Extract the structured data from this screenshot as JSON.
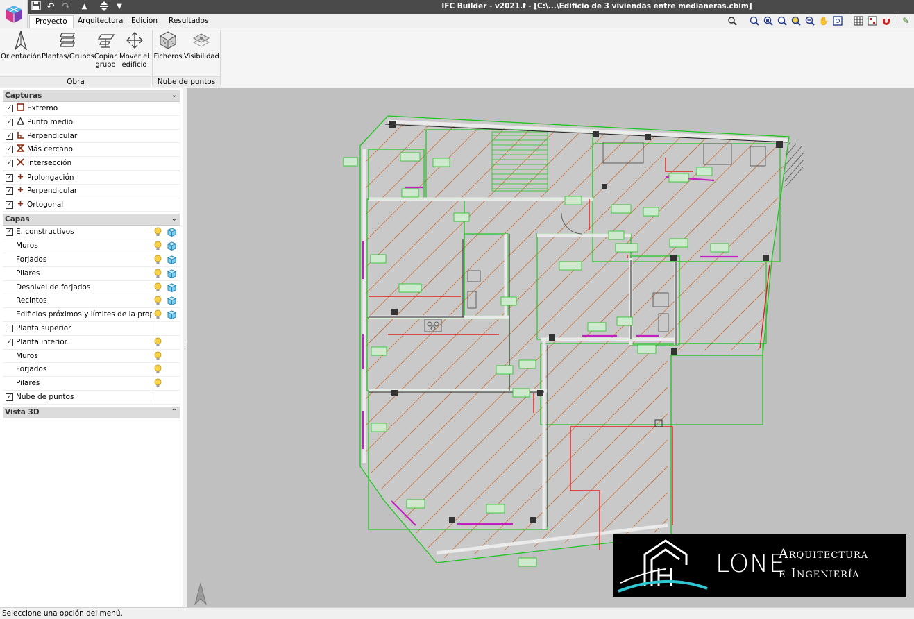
{
  "window": {
    "title": "IFC Builder - v2021.f - [C:\\...\\Edificio de 3 viviendas entre medianeras.cbim]"
  },
  "tabs": [
    {
      "label": "Proyecto",
      "active": true
    },
    {
      "label": "Arquitectura",
      "active": false
    },
    {
      "label": "Edición",
      "active": false
    },
    {
      "label": "Resultados",
      "active": false
    }
  ],
  "ribbon": {
    "obra": {
      "group_label": "Obra",
      "buttons": [
        {
          "label": "Orientación",
          "icon": "north-arrow-icon"
        },
        {
          "label": "Plantas/Grupos",
          "icon": "floors-stack-icon"
        },
        {
          "label": "Copiar grupo",
          "icon": "copy-floor-icon"
        },
        {
          "label": "Mover el edificio",
          "icon": "move-arrows-icon"
        }
      ]
    },
    "nube": {
      "group_label": "Nube de puntos",
      "buttons": [
        {
          "label": "Ficheros",
          "icon": "point-cloud-file-icon"
        },
        {
          "label": "Visibilidad",
          "icon": "visibility-layer-icon"
        }
      ]
    }
  },
  "capturas": {
    "header": "Capturas",
    "items": [
      {
        "label": "Extremo",
        "checked": true,
        "icon": "endpoint-square-icon"
      },
      {
        "label": "Punto medio",
        "checked": true,
        "icon": "midpoint-triangle-icon"
      },
      {
        "label": "Perpendicular",
        "checked": true,
        "icon": "perpendicular-icon"
      },
      {
        "label": "Más cercano",
        "checked": true,
        "icon": "nearest-hourglass-icon"
      },
      {
        "label": "Intersección",
        "checked": true,
        "icon": "intersection-x-icon"
      },
      {
        "label": "Prolongación",
        "checked": true,
        "icon": "plus-icon"
      },
      {
        "label": "Perpendicular",
        "checked": true,
        "icon": "plus-icon"
      },
      {
        "label": "Ortogonal",
        "checked": true,
        "icon": "plus-icon"
      }
    ]
  },
  "capas": {
    "header": "Capas",
    "items": [
      {
        "label": "E. constructivos",
        "checkbox": true,
        "checked": true,
        "bulb": true,
        "cube": true,
        "indent": false
      },
      {
        "label": "Muros",
        "checkbox": false,
        "bulb": true,
        "cube": true,
        "indent": true
      },
      {
        "label": "Forjados",
        "checkbox": false,
        "bulb": true,
        "cube": true,
        "indent": true
      },
      {
        "label": "Pilares",
        "checkbox": false,
        "bulb": true,
        "cube": true,
        "indent": true
      },
      {
        "label": "Desnivel de forjados",
        "checkbox": false,
        "bulb": true,
        "cube": true,
        "indent": true
      },
      {
        "label": "Recintos",
        "checkbox": false,
        "bulb": true,
        "cube": true,
        "indent": true
      },
      {
        "label": "Edificios próximos y límites de la propiedad",
        "checkbox": false,
        "bulb": true,
        "cube": true,
        "indent": true
      },
      {
        "label": "Planta superior",
        "checkbox": true,
        "checked": false,
        "bulb": false,
        "cube": false,
        "indent": false
      },
      {
        "label": "Planta inferior",
        "checkbox": true,
        "checked": true,
        "bulb": true,
        "cube": false,
        "indent": false
      },
      {
        "label": "Muros",
        "checkbox": false,
        "bulb": true,
        "cube": false,
        "indent": true
      },
      {
        "label": "Forjados",
        "checkbox": false,
        "bulb": true,
        "cube": false,
        "indent": true
      },
      {
        "label": "Pilares",
        "checkbox": false,
        "bulb": true,
        "cube": false,
        "indent": true
      },
      {
        "label": "Nube de puntos",
        "checkbox": true,
        "checked": true,
        "bulb": false,
        "cube": false,
        "indent": false
      }
    ]
  },
  "vista3d": {
    "header": "Vista 3D"
  },
  "status": {
    "text": "Seleccione una opción del menú."
  },
  "logo": {
    "word": "LONE",
    "line1": "Arquitectura",
    "line2": "e Ingeniería"
  },
  "colors": {
    "titlebar": "#4a4a4a",
    "viewport_bg": "#c0c0c0",
    "wall_outline": "#1fc41f",
    "hatch": "#c86428",
    "red_lines": "#e02020",
    "magenta": "#c020c0"
  }
}
